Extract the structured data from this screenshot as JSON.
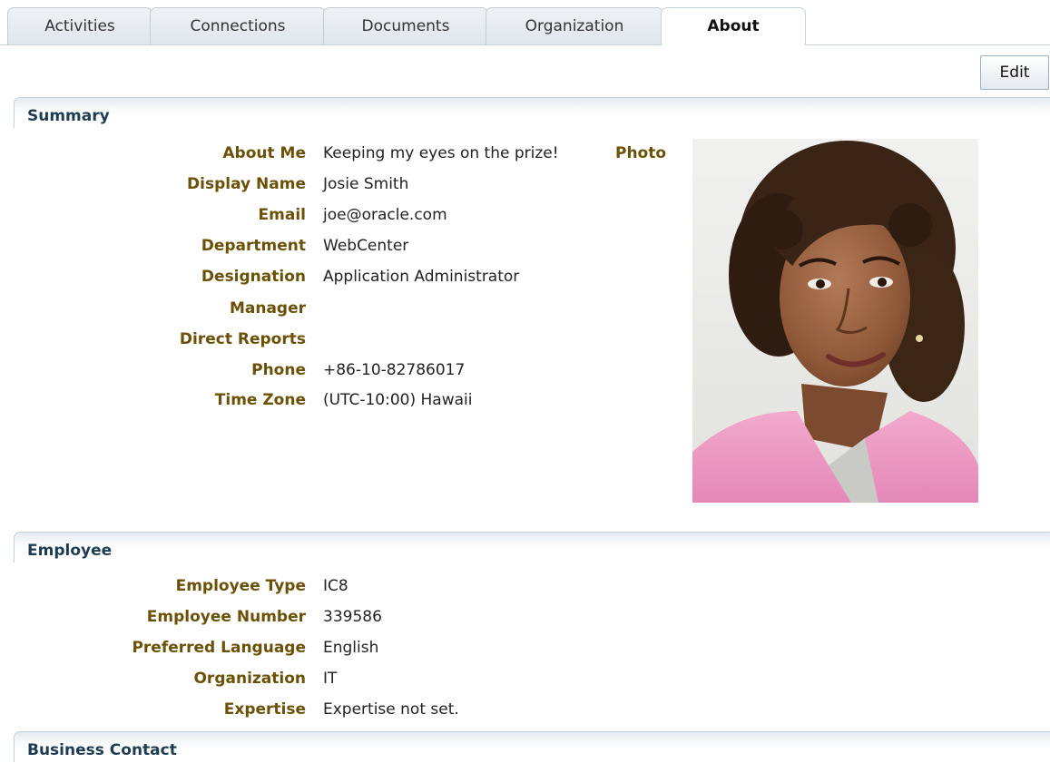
{
  "tabs": [
    {
      "label": "Activities"
    },
    {
      "label": "Connections"
    },
    {
      "label": "Documents"
    },
    {
      "label": "Organization"
    },
    {
      "label": "About",
      "active": true
    }
  ],
  "toolbar": {
    "edit_label": "Edit"
  },
  "summary": {
    "title": "Summary",
    "photo_label": "Photo",
    "fields": [
      {
        "label": "About Me",
        "value": "Keeping my eyes on the prize!"
      },
      {
        "label": "Display Name",
        "value": "Josie Smith"
      },
      {
        "label": "Email",
        "value": "joe@oracle.com"
      },
      {
        "label": "Department",
        "value": "WebCenter"
      },
      {
        "label": "Designation",
        "value": "Application Administrator"
      },
      {
        "label": "Manager",
        "value": ""
      },
      {
        "label": "Direct Reports",
        "value": ""
      },
      {
        "label": "Phone",
        "value": "+86-10-82786017"
      },
      {
        "label": "Time Zone",
        "value": "(UTC-10:00) Hawaii"
      }
    ]
  },
  "employee": {
    "title": "Employee",
    "fields": [
      {
        "label": "Employee Type",
        "value": "IC8"
      },
      {
        "label": "Employee Number",
        "value": "339586"
      },
      {
        "label": "Preferred Language",
        "value": "English"
      },
      {
        "label": "Organization",
        "value": "IT"
      },
      {
        "label": "Expertise",
        "value": "Expertise not set."
      }
    ]
  },
  "business_contact": {
    "title": "Business Contact"
  },
  "colors": {
    "label": "#6b5108",
    "section_title": "#1f3d52",
    "tab_bg": "#e4eaef"
  }
}
